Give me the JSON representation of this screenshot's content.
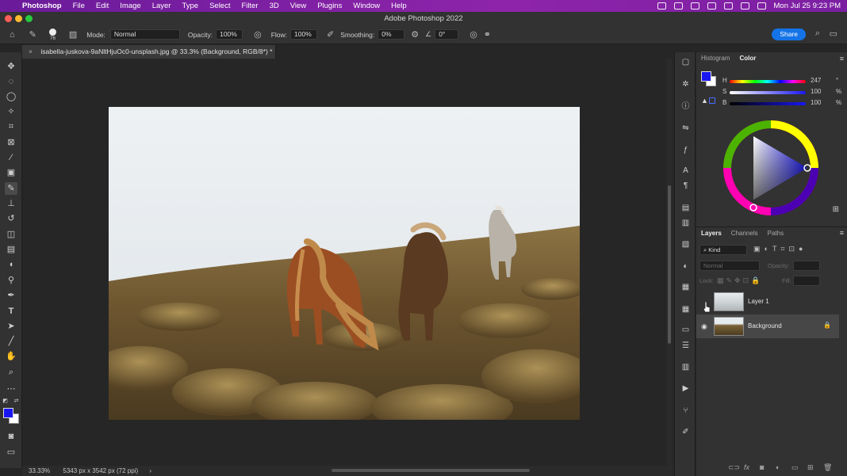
{
  "menubar": {
    "app": "Photoshop",
    "items": [
      "File",
      "Edit",
      "Image",
      "Layer",
      "Type",
      "Select",
      "Filter",
      "3D",
      "View",
      "Plugins",
      "Window",
      "Help"
    ],
    "clock": "Mon Jul 25  9:23 PM"
  },
  "window": {
    "title": "Adobe Photoshop 2022"
  },
  "options": {
    "brush_size": "76",
    "mode_label": "Mode:",
    "mode_value": "Normal",
    "opacity_label": "Opacity:",
    "opacity_value": "100%",
    "flow_label": "Flow:",
    "flow_value": "100%",
    "smoothing_label": "Smoothing:",
    "smoothing_value": "0%",
    "angle_value": "0°",
    "share_label": "Share"
  },
  "document": {
    "tab_title": "isabella-juskova-9aNltHjuOc0-unsplash.jpg @ 33.3% (Background, RGB/8*) *",
    "zoom": "33.33%",
    "dimensions": "5343 px x 3542 px (72 ppi)"
  },
  "color_panel": {
    "tabs": [
      "Histogram",
      "Color"
    ],
    "h_label": "H",
    "h_value": "247",
    "h_unit": "°",
    "s_label": "S",
    "s_value": "100",
    "s_unit": "%",
    "b_label": "B",
    "b_value": "100",
    "b_unit": "%",
    "foreground_color": "#1a16f2"
  },
  "layers_panel": {
    "tabs": [
      "Layers",
      "Channels",
      "Paths"
    ],
    "filter_label": "Kind",
    "blend_mode": "Normal",
    "opacity_label": "Opacity:",
    "lock_label": "Lock:",
    "fill_label": "Fill:",
    "layers": [
      {
        "name": "Layer 1"
      },
      {
        "name": "Background"
      }
    ]
  },
  "colors": {
    "accent": "#1473e6",
    "menubar": "#7b1fa2"
  }
}
